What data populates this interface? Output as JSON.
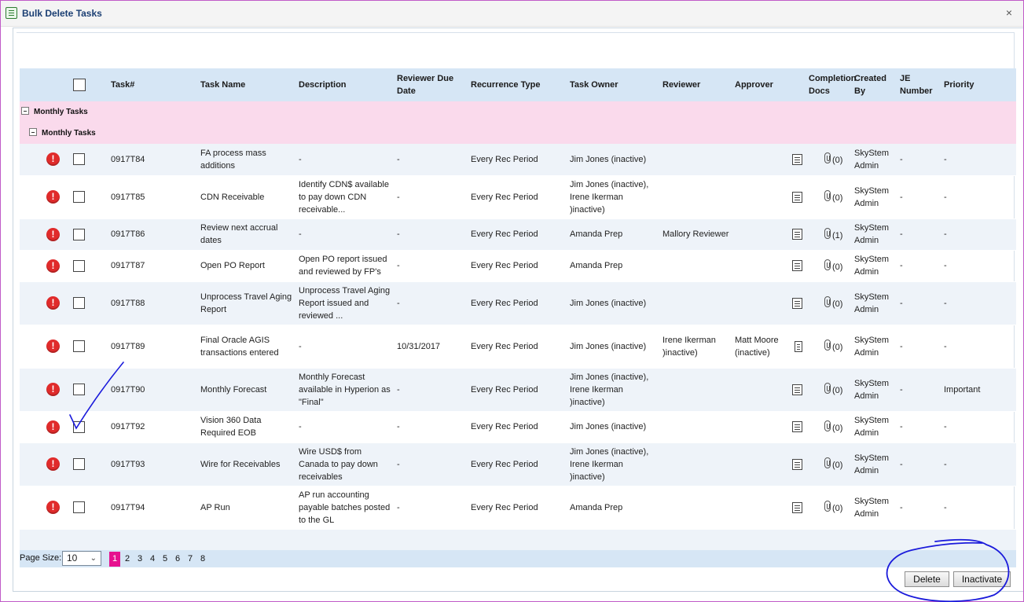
{
  "window": {
    "title": "Bulk Delete Tasks",
    "close_label": "×"
  },
  "columns": [
    "Task#",
    "Task Name",
    "Description",
    "Reviewer Due Date",
    "Recurrence Type",
    "Task Owner",
    "Reviewer",
    "Approver",
    "Completion Docs",
    "Created By",
    "JE Number",
    "Priority"
  ],
  "groups": {
    "level1": "Monthly Tasks",
    "level2": "Monthly Tasks"
  },
  "rows": [
    {
      "task_num": "0917T84",
      "task_name": "FA process mass additions",
      "description": "-",
      "due_date": "-",
      "recurrence": "Every Rec Period",
      "owner": "Jim Jones (inactive)",
      "reviewer": "",
      "approver": "",
      "docs_count": "(0)",
      "created_by": "SkyStem Admin",
      "je_number": "-",
      "priority": "-"
    },
    {
      "task_num": "0917T85",
      "task_name": "CDN Receivable",
      "description": "Identify CDN$ available to pay down CDN receivable...",
      "due_date": "-",
      "recurrence": "Every Rec Period",
      "owner": "Jim Jones (inactive), Irene Ikerman )inactive)",
      "reviewer": "",
      "approver": "",
      "docs_count": "(0)",
      "created_by": "SkyStem Admin",
      "je_number": "-",
      "priority": "-"
    },
    {
      "task_num": "0917T86",
      "task_name": "Review next accrual dates",
      "description": "-",
      "due_date": "-",
      "recurrence": "Every Rec Period",
      "owner": "Amanda Prep",
      "reviewer": "Mallory Reviewer",
      "approver": "",
      "docs_count": "(1)",
      "created_by": "SkyStem Admin",
      "je_number": "-",
      "priority": "-"
    },
    {
      "task_num": "0917T87",
      "task_name": "Open PO Report",
      "description": "Open PO report issued and reviewed by FP's",
      "due_date": "-",
      "recurrence": "Every Rec Period",
      "owner": "Amanda Prep",
      "reviewer": "",
      "approver": "",
      "docs_count": "(0)",
      "created_by": "SkyStem Admin",
      "je_number": "-",
      "priority": "-"
    },
    {
      "task_num": "0917T88",
      "task_name": "Unprocess Travel Aging Report",
      "description": "Unprocess Travel Aging Report issued and reviewed ...",
      "due_date": "-",
      "recurrence": "Every Rec Period",
      "owner": "Jim Jones (inactive)",
      "reviewer": "",
      "approver": "",
      "docs_count": "(0)",
      "created_by": "SkyStem Admin",
      "je_number": "-",
      "priority": "-"
    },
    {
      "task_num": "0917T89",
      "task_name": "Final Oracle AGIS transactions entered",
      "description": "-",
      "due_date": "10/31/2017",
      "recurrence": "Every Rec Period",
      "owner": "Jim Jones (inactive)",
      "reviewer": "Irene Ikerman )inactive)",
      "approver": "Matt Moore (inactive)",
      "docs_count": "(0)",
      "created_by": "SkyStem Admin",
      "je_number": "-",
      "priority": "-"
    },
    {
      "task_num": "0917T90",
      "task_name": "Monthly Forecast",
      "description": "Monthly Forecast available in Hyperion as \"Final\"",
      "due_date": "-",
      "recurrence": "Every Rec Period",
      "owner": "Jim Jones (inactive), Irene Ikerman )inactive)",
      "reviewer": "",
      "approver": "",
      "docs_count": "(0)",
      "created_by": "SkyStem Admin",
      "je_number": "-",
      "priority": "Important"
    },
    {
      "task_num": "0917T92",
      "task_name": "Vision 360 Data Required EOB",
      "description": "-",
      "due_date": "-",
      "recurrence": "Every Rec Period",
      "owner": "Jim Jones (inactive)",
      "reviewer": "",
      "approver": "",
      "docs_count": "(0)",
      "created_by": "SkyStem Admin",
      "je_number": "-",
      "priority": "-"
    },
    {
      "task_num": "0917T93",
      "task_name": "Wire for Receivables",
      "description": "Wire USD$ from Canada to pay down receivables",
      "due_date": "-",
      "recurrence": "Every Rec Period",
      "owner": "Jim Jones (inactive), Irene Ikerman )inactive)",
      "reviewer": "",
      "approver": "",
      "docs_count": "(0)",
      "created_by": "SkyStem Admin",
      "je_number": "-",
      "priority": "-"
    },
    {
      "task_num": "0917T94",
      "task_name": "AP Run",
      "description": "AP run accounting payable batches posted to the GL",
      "due_date": "-",
      "recurrence": "Every Rec Period",
      "owner": "Amanda Prep",
      "reviewer": "",
      "approver": "",
      "docs_count": "(0)",
      "created_by": "SkyStem Admin",
      "je_number": "-",
      "priority": "-"
    }
  ],
  "pager": {
    "page_size_label": "Page Size:",
    "page_size_value": "10",
    "pages": [
      "1",
      "2",
      "3",
      "4",
      "5",
      "6",
      "7",
      "8"
    ],
    "current_page": "1"
  },
  "buttons": {
    "delete": "Delete",
    "inactivate": "Inactivate"
  },
  "icons": {
    "status": "alert-icon",
    "docs": "document-icon",
    "attachment": "paperclip-icon"
  },
  "colors": {
    "header_bg": "#d6e6f5",
    "group_bg": "#fadaec",
    "row_alt_bg": "#eef3f9",
    "alert": "#e02b2b",
    "active_page": "#e6118f",
    "annotation": "#1a1adb"
  }
}
